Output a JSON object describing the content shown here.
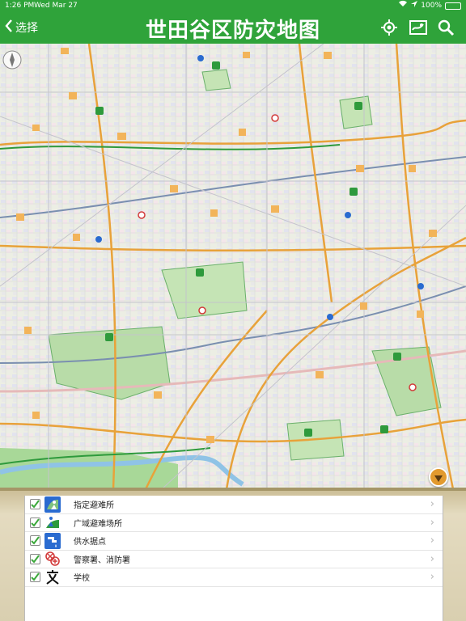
{
  "status": {
    "time": "1:26 PM",
    "date": "Wed Mar 27",
    "battery": "100%"
  },
  "nav": {
    "back_label": "选择",
    "title": "世田谷区防灾地图",
    "icons": [
      "locate-icon",
      "map-layers-icon",
      "search-icon"
    ]
  },
  "legend": {
    "items": [
      {
        "label": "指定避难所",
        "icon": "shelter-icon",
        "checked": true
      },
      {
        "label": "广域避难场所",
        "icon": "evacuation-area-icon",
        "checked": true
      },
      {
        "label": "供水据点",
        "icon": "water-supply-icon",
        "checked": true
      },
      {
        "label": "警察署、消防署",
        "icon": "police-fire-icon",
        "checked": true
      },
      {
        "label": "学校",
        "icon": "school-icon",
        "checked": true
      }
    ]
  },
  "colors": {
    "header": "#2fa33a",
    "park": "#b8dca8",
    "road_main": "#e8a23a",
    "road_green": "#2e9a3c"
  }
}
